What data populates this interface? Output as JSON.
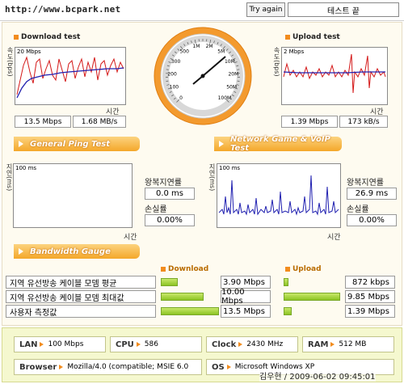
{
  "header": {
    "url": "http://www.bcpark.net",
    "try_again": "Try again",
    "end_test": "테스트 끝"
  },
  "download": {
    "title": "Download test",
    "ylabel": "속도(bps)",
    "scale": "20 Mbps",
    "xlabel": "시간",
    "mbps": "13.5 Mbps",
    "mbs": "1.68 MB/s"
  },
  "upload": {
    "title": "Upload test",
    "ylabel": "속도(bps)",
    "scale": "2 Mbps",
    "xlabel": "시간",
    "mbps": "1.39 Mbps",
    "kbs": "173 kB/s"
  },
  "speedometer": {
    "ticks": [
      "0",
      "100",
      "200",
      "300",
      "500",
      "1M",
      "2M",
      "5M",
      "10M",
      "20M",
      "50M",
      "100M"
    ]
  },
  "ping": {
    "banner": "General Ping Test",
    "ylabel": "지연(ms)",
    "scale": "100 ms",
    "xlabel": "시간",
    "rtt_label": "왕복지연률",
    "rtt": "0.0 ms",
    "loss_label": "손실률",
    "loss": "0.00%"
  },
  "game": {
    "banner": "Network Game & VoIP Test",
    "ylabel": "지연(ms)",
    "scale": "100 ms",
    "xlabel": "시간",
    "rtt_label": "왕복지연률",
    "rtt": "26.9 ms",
    "loss_label": "손실률",
    "loss": "0.00%"
  },
  "gauge": {
    "banner": "Bandwidth Gauge",
    "download_header": "Download",
    "upload_header": "Upload",
    "rows": [
      {
        "label": "지역 유선방송 케이블 모뎀 평균",
        "down": "3.90 Mbps",
        "down_frac": 0.29,
        "up": "872 kbps",
        "up_frac": 0.09
      },
      {
        "label": "지역 유선방송 케이블 모뎀 최대값",
        "down": "10.00 Mbps",
        "down_frac": 0.74,
        "up": "9.85 Mbps",
        "up_frac": 1.0
      },
      {
        "label": "사용자 측정값",
        "down": "13.5 Mbps",
        "down_frac": 1.0,
        "up": "1.39 Mbps",
        "up_frac": 0.14
      }
    ]
  },
  "system": {
    "lan_key": "LAN",
    "lan": "100 Mbps",
    "cpu_key": "CPU",
    "cpu": "586",
    "clock_key": "Clock",
    "clock": "2430 MHz",
    "ram_key": "RAM",
    "ram": "512 MB",
    "browser_key": "Browser",
    "browser": "Mozilla/4.0 (compatible; MSIE 6.0",
    "os_key": "OS",
    "os": "Microsoft Windows XP",
    "stamp": "김우현 / 2009-06-02 09:45:01"
  },
  "colors": {
    "accent": "#f28c1e",
    "download_line": "#d41818",
    "avg_line": "#2020b0",
    "bar_green": "#8cc424",
    "footer_bg": "#f5f8cf"
  }
}
